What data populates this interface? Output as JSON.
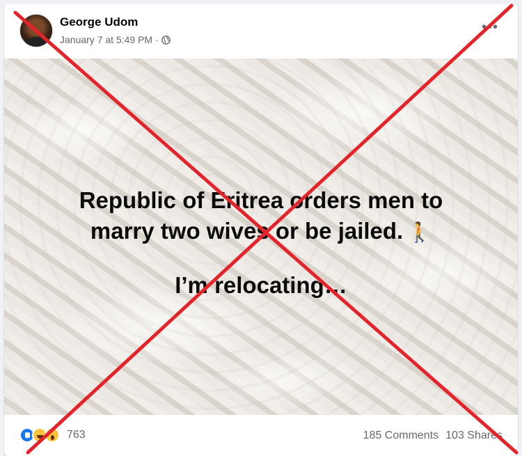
{
  "post": {
    "author_name": "George Udom",
    "timestamp": "January 7 at 5:49 PM",
    "separator": "·",
    "privacy_icon": "globe-icon",
    "more_icon": "more-options-icon",
    "image_text": {
      "line1": "Republic of Eritrea orders men to",
      "line2": "marry two wives or be jailed.",
      "line2_emoji": "🚶",
      "line3": "I’m relocating…"
    },
    "reactions": {
      "icons": [
        "like-icon",
        "haha-icon",
        "wow-icon"
      ],
      "count": "763"
    },
    "comments": "185 Comments",
    "shares": "103 Shares"
  },
  "colors": {
    "cross_mark": "#e3242b",
    "secondary_text": "#65676b",
    "like_blue": "#1877f2"
  }
}
